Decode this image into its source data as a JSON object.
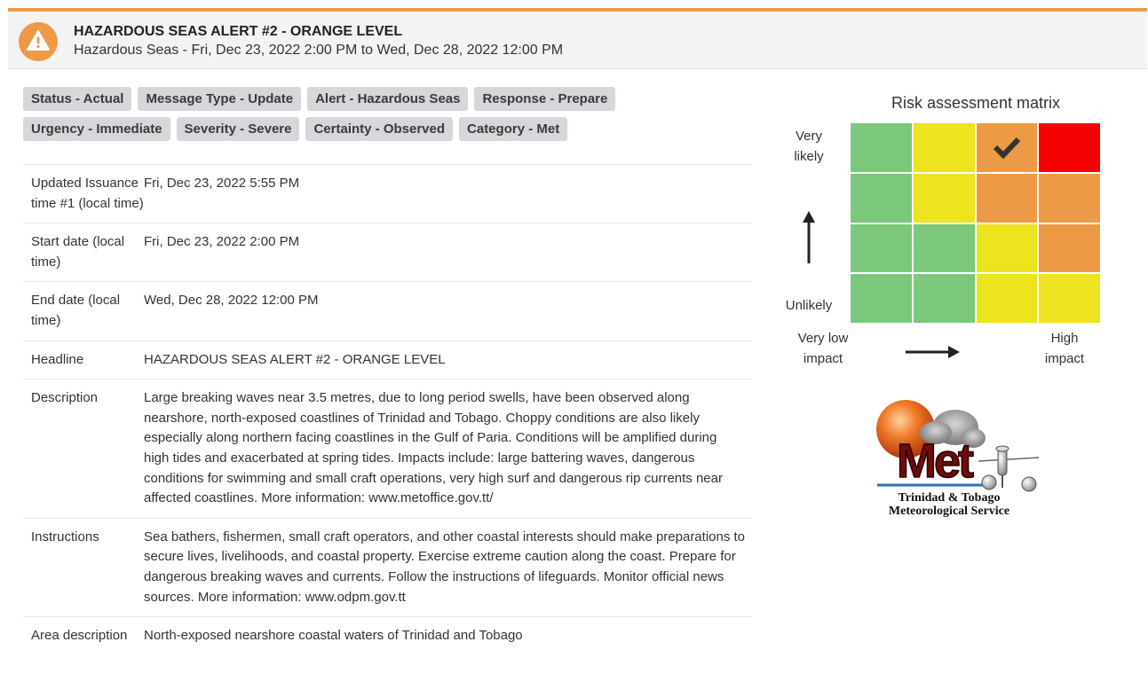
{
  "header": {
    "title": "HAZARDOUS SEAS ALERT #2 - ORANGE LEVEL",
    "subtitle": "Hazardous Seas - Fri, Dec 23, 2022 2:00 PM to Wed, Dec 28, 2022 12:00 PM",
    "icon": "warning-icon",
    "accent_color": "#ec9a45"
  },
  "tags": {
    "row1": [
      "Status - Actual",
      "Message Type - Update",
      "Alert - Hazardous Seas",
      "Response - Prepare"
    ],
    "row2": [
      "Urgency - Immediate",
      "Severity - Severe",
      "Certainty - Observed",
      "Category - Met"
    ]
  },
  "details": [
    {
      "label": "Updated Issuance time #1 (local time)",
      "value": "Fri, Dec 23, 2022 5:55 PM"
    },
    {
      "label": "Start date (local time)",
      "value": "Fri, Dec 23, 2022 2:00 PM"
    },
    {
      "label": "End date (local time)",
      "value": "Wed, Dec 28, 2022 12:00 PM"
    },
    {
      "label": "Headline",
      "value": "HAZARDOUS SEAS ALERT #2 - ORANGE LEVEL"
    },
    {
      "label": "Description",
      "value": "Large breaking waves near 3.5 metres, due to long period swells, have been observed along nearshore, north-exposed coastlines of Trinidad and Tobago. Choppy conditions are also likely especially along northern facing coastlines in the Gulf of Paria. Conditions will be amplified during high tides and exacerbated at spring tides. Impacts include: large battering waves, dangerous conditions for swimming and small craft operations, very high surf and dangerous rip currents near affected coastlines. More information: www.metoffice.gov.tt/"
    },
    {
      "label": "Instructions",
      "value": "Sea bathers, fishermen, small craft operators, and other coastal interests should make preparations to secure lives, livelihoods, and coastal property. Exercise extreme caution along the coast. Prepare for dangerous breaking waves and currents. Follow the instructions of lifeguards. Monitor official news sources. More information: www.odpm.gov.tt"
    },
    {
      "label": "Area description",
      "value": "North-exposed nearshore coastal waters of Trinidad and Tobago"
    }
  ],
  "risk_matrix": {
    "title": "Risk assessment matrix",
    "likelihood_high": "Very likely",
    "likelihood_low": "Unlikely",
    "impact_low": "Very low impact",
    "impact_high": "High impact",
    "selected": {
      "row": 0,
      "col": 2
    },
    "colors": {
      "green": "#7bc87a",
      "yellow": "#ede31f",
      "orange": "#ec9a45",
      "red": "#f60101"
    },
    "grid": [
      [
        "green",
        "yellow",
        "orange",
        "red"
      ],
      [
        "green",
        "yellow",
        "orange",
        "orange"
      ],
      [
        "green",
        "green",
        "yellow",
        "orange"
      ],
      [
        "green",
        "green",
        "yellow",
        "yellow"
      ]
    ]
  },
  "logo": {
    "line1": "Trinidad & Tobago",
    "line2": "Meteorological Service",
    "mark": "Met"
  }
}
